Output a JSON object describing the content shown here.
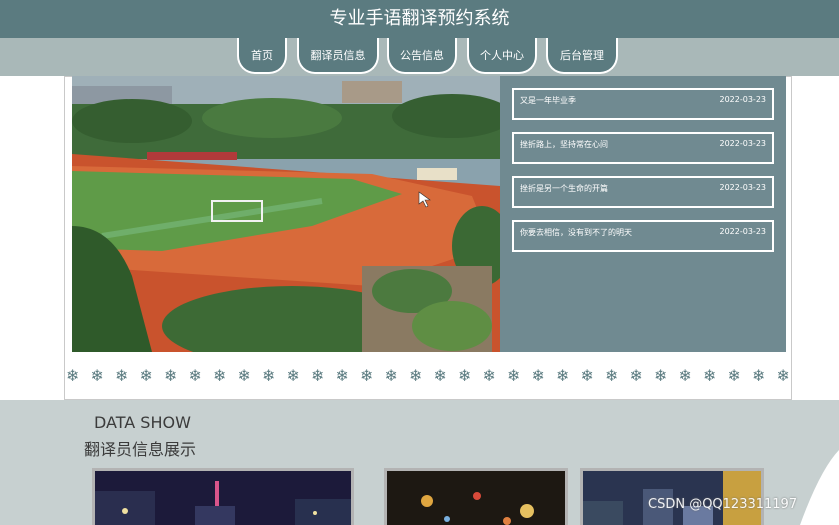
{
  "header": {
    "title": "专业手语翻译预约系统"
  },
  "nav": {
    "items": [
      "首页",
      "翻译员信息",
      "公告信息",
      "个人中心",
      "后台管理"
    ]
  },
  "notices": [
    {
      "title": "又是一年毕业季",
      "date": "2022-03-23"
    },
    {
      "title": "挫折路上，坚持常在心间",
      "date": "2022-03-23"
    },
    {
      "title": "挫折是另一个生命的开篇",
      "date": "2022-03-23"
    },
    {
      "title": "你要去相信，没有到不了的明天",
      "date": "2022-03-23"
    }
  ],
  "section": {
    "eyebrow": "DATA SHOW",
    "title": "翻译员信息展示"
  },
  "watermark": "CSDN @QQ123311197",
  "colors": {
    "header_bg": "#5b7b80",
    "nav_bg": "#a9b8b8",
    "notice_bg": "#708a91",
    "section_bg": "#c7d0d0"
  },
  "icons": {
    "ornament": "snowflake-icon",
    "cursor": "mouse-pointer-icon"
  }
}
